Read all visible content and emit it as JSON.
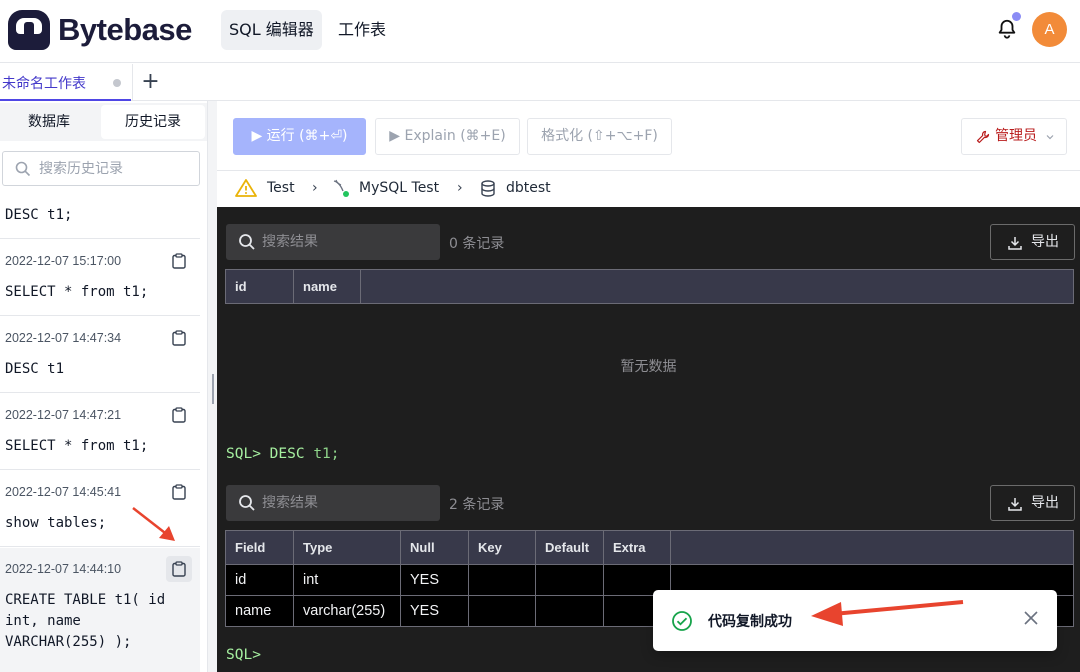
{
  "header": {
    "brand": "Bytebase",
    "nav": [
      "SQL 编辑器",
      "工作表"
    ],
    "avatar_initial": "A"
  },
  "tabs": {
    "sheet_label": "未命名工作表",
    "add_label": "+"
  },
  "sidebar": {
    "tabs": [
      "数据库",
      "历史记录"
    ],
    "search_placeholder": "搜索历史记录",
    "history": [
      {
        "time": "",
        "sql": "DESC t1;"
      },
      {
        "time": "2022-12-07 15:17:00",
        "sql": "SELECT * from t1;"
      },
      {
        "time": "2022-12-07 14:47:34",
        "sql": "DESC t1"
      },
      {
        "time": "2022-12-07 14:47:21",
        "sql": "SELECT * from t1;"
      },
      {
        "time": "2022-12-07 14:45:41",
        "sql": "show tables;"
      },
      {
        "time": "2022-12-07 14:44:10",
        "sql": "CREATE TABLE t1( id\nint, name\nVARCHAR(255) );"
      }
    ]
  },
  "toolbar": {
    "run_label": "▶ 运行 (⌘+⏎)",
    "explain_label": "▶ Explain (⌘+E)",
    "format_label": "格式化 (⇧+⌥+F)",
    "admin_label": "管理员"
  },
  "breadcrumb": {
    "environment": "Test",
    "instance": "MySQL Test",
    "database": "dbtest"
  },
  "results": [
    {
      "search_placeholder": "搜索结果",
      "count_label": "0 条记录",
      "export_label": "导出",
      "columns": [
        "id",
        "name"
      ],
      "rows": [],
      "empty_text": "暂无数据"
    },
    {
      "prompt": "SQL>",
      "command": "DESC",
      "argument": "t1;",
      "search_placeholder": "搜索结果",
      "count_label": "2 条记录",
      "export_label": "导出",
      "columns": [
        "Field",
        "Type",
        "Null",
        "Key",
        "Default",
        "Extra"
      ],
      "rows": [
        [
          "id",
          "int",
          "YES",
          "",
          "",
          ""
        ],
        [
          "name",
          "varchar(255)",
          "YES",
          "",
          "",
          ""
        ]
      ]
    }
  ],
  "console": {
    "prompt": "SQL>"
  },
  "toast": {
    "message": "代码复制成功"
  },
  "colors": {
    "accent": "#4f46e5",
    "run_button": "#a5b4fc",
    "console_bg": "#1e1e1e",
    "success": "#16a34a",
    "annotation_arrow": "#e8442e"
  }
}
